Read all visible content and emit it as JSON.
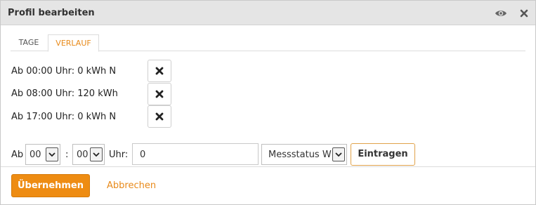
{
  "dialog": {
    "title": "Profil bearbeiten",
    "icons": [
      "eye-icon",
      "close-icon"
    ]
  },
  "tabs": [
    {
      "label": "TAGE",
      "active": false
    },
    {
      "label": "VERLAUF",
      "active": true
    }
  ],
  "entries": [
    {
      "text": "Ab 00:00 Uhr: 0 kWh N"
    },
    {
      "text": "Ab 08:00 Uhr: 120 kWh"
    },
    {
      "text": "Ab 17:00 Uhr: 0 kWh N"
    }
  ],
  "form": {
    "ab_label": "Ab",
    "hour_value": "00",
    "colon": ":",
    "minute_value": "00",
    "uhr_label": "Uhr:",
    "amount_value": "0",
    "status_value": "Messstatus W",
    "submit_label": "Eintragen"
  },
  "footer": {
    "primary_label": "Übernehmen",
    "cancel_label": "Abbrechen"
  },
  "colors": {
    "accent": "#ee8c12",
    "link": "#e88a1a",
    "titlebar": "#e5e5e5"
  }
}
